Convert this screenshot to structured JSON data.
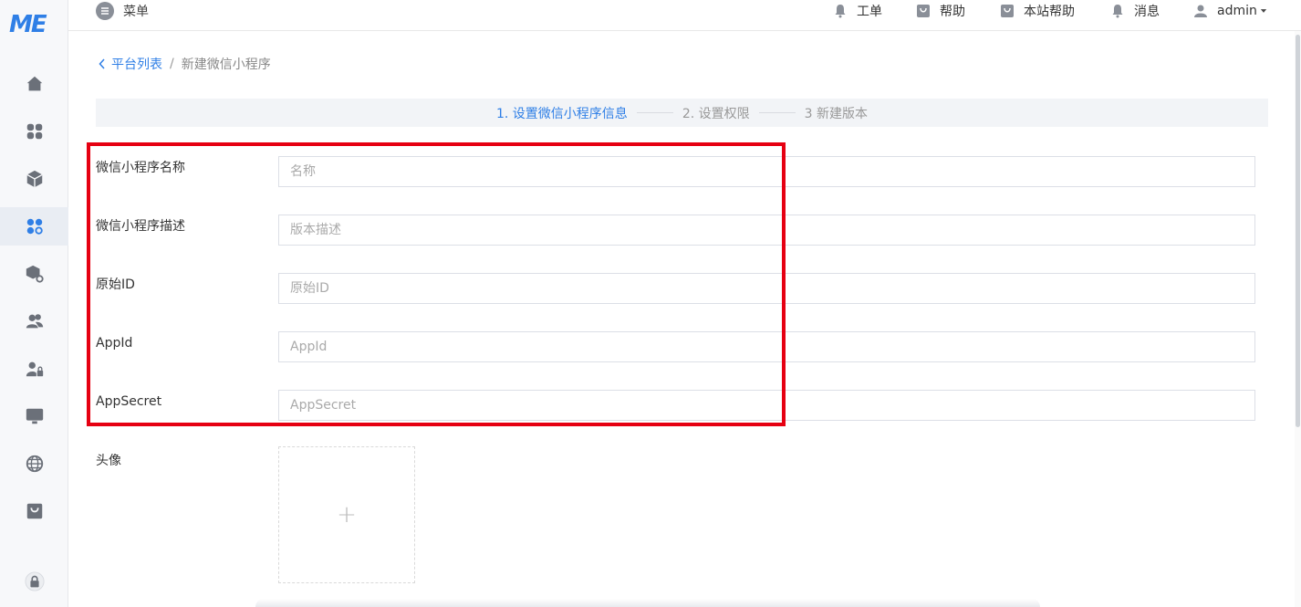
{
  "brand": {
    "logo_text": "ME",
    "color": "#2f7fe6"
  },
  "topbar": {
    "menu_label": "菜单",
    "items": [
      {
        "icon": "bell-icon",
        "label": "工单"
      },
      {
        "icon": "bag-icon",
        "label": "帮助"
      },
      {
        "icon": "bag-icon",
        "label": "本站帮助"
      },
      {
        "icon": "bell-icon",
        "label": "消息"
      },
      {
        "icon": "user-icon",
        "label": "admin"
      }
    ]
  },
  "breadcrumb": {
    "back_label": "平台列表",
    "separator": "/",
    "current": "新建微信小程序"
  },
  "steps": [
    {
      "label": "1. 设置微信小程序信息",
      "active": true
    },
    {
      "label": "2. 设置权限",
      "active": false
    },
    {
      "label": "3 新建版本",
      "active": false
    }
  ],
  "form": {
    "fields": [
      {
        "label": "微信小程序名称",
        "placeholder": "名称"
      },
      {
        "label": "微信小程序描述",
        "placeholder": "版本描述"
      },
      {
        "label": "原始ID",
        "placeholder": "原始ID"
      },
      {
        "label": "AppId",
        "placeholder": "AppId"
      },
      {
        "label": "AppSecret",
        "placeholder": "AppSecret"
      }
    ],
    "avatar_label": "头像",
    "upload_glyph": "+"
  },
  "highlight_color": "#e60012"
}
